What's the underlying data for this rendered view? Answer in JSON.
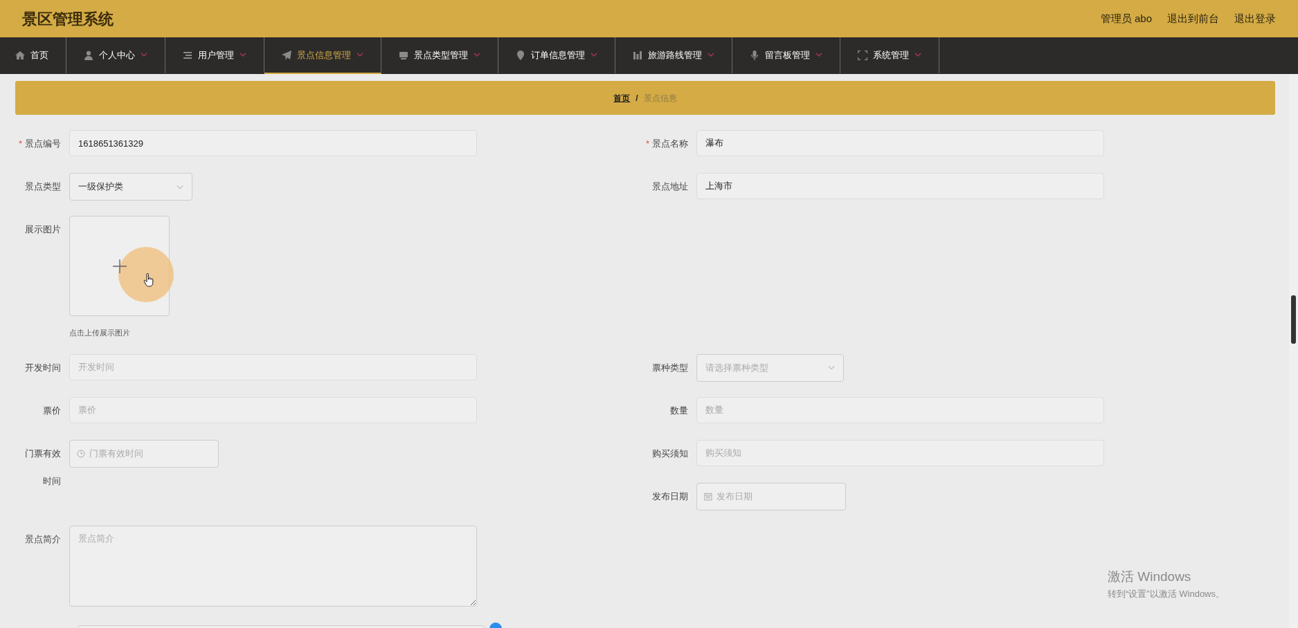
{
  "header": {
    "title": "景区管理系统",
    "links": [
      "管理员 abo",
      "退出到前台",
      "退出登录"
    ]
  },
  "nav": [
    {
      "label": "首页",
      "selected": false,
      "dropdown": false
    },
    {
      "label": "个人中心",
      "selected": false,
      "dropdown": true
    },
    {
      "label": "用户管理",
      "selected": false,
      "dropdown": true
    },
    {
      "label": "景点信息管理",
      "selected": true,
      "dropdown": true
    },
    {
      "label": "景点类型管理",
      "selected": false,
      "dropdown": true
    },
    {
      "label": "订单信息管理",
      "selected": false,
      "dropdown": true
    },
    {
      "label": "旅游路线管理",
      "selected": false,
      "dropdown": true
    },
    {
      "label": "留言板管理",
      "selected": false,
      "dropdown": true
    },
    {
      "label": "系统管理",
      "selected": false,
      "dropdown": true
    }
  ],
  "breadcrumb": {
    "items": [
      "首页",
      "景点信息"
    ],
    "separator": "/"
  },
  "form": {
    "rows": [
      {
        "left": [
          {
            "kind": "text",
            "label": "景点编号",
            "required_mark": "*",
            "value": "1618651361329"
          }
        ],
        "right": [
          {
            "kind": "text",
            "label": "景点名称",
            "required_mark": "*",
            "value": "瀑布"
          }
        ]
      },
      {
        "left": [
          {
            "kind": "select",
            "label": "景点类型",
            "value": "一级保护类"
          }
        ],
        "right": [
          {
            "kind": "text",
            "label": "景点地址",
            "value": "上海市"
          }
        ]
      },
      {
        "left": [
          {
            "kind": "upload",
            "label": "展示图片",
            "hint": "点击上传展示图片"
          }
        ]
      },
      {
        "left": [
          {
            "kind": "text",
            "label": "开发时间",
            "placeholder": "开发时间"
          }
        ],
        "right": [
          {
            "kind": "select",
            "label": "票种类型",
            "placeholder": "请选择票种类型"
          }
        ]
      },
      {
        "left": [
          {
            "kind": "text",
            "label": "票价",
            "placeholder": "票价"
          }
        ],
        "right": [
          {
            "kind": "text",
            "label": "数量",
            "placeholder": "数量"
          }
        ]
      },
      {
        "left": [
          {
            "kind": "time",
            "label": "门票有效时间",
            "placeholder": "门票有效时间"
          }
        ],
        "right": [
          {
            "kind": "text",
            "label": "购买须知",
            "placeholder": "购买须知"
          },
          {
            "kind": "date",
            "label": "发布日期",
            "placeholder": "发布日期"
          }
        ]
      },
      {
        "left": [
          {
            "kind": "textarea",
            "label": "景点简介",
            "placeholder": "景点简介"
          }
        ]
      }
    ]
  },
  "activation_notice": {
    "title": "激活 Windows",
    "text": "转到“设置”以激活 Windows。"
  }
}
